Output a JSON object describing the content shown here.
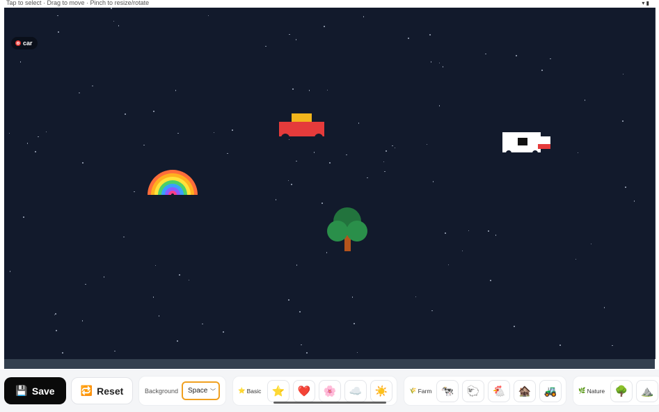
{
  "status_bar": {
    "hint": "Tap to select · Drag to move · Pinch to resize/rotate"
  },
  "canvas": {
    "background": "#121a2c",
    "selected_label": "car",
    "stickers": [
      "car",
      "bus",
      "rainbow",
      "tree"
    ]
  },
  "toolbar": {
    "save_label": "Save",
    "save_icon": "💾",
    "reset_label": "Reset",
    "reset_icon": "🔁",
    "background": {
      "label": "Background",
      "value": "Space"
    },
    "groups": [
      {
        "label": "Basic",
        "icon": "⭐",
        "items": [
          "⭐",
          "❤️",
          "🌸",
          "☁️",
          "☀️"
        ]
      },
      {
        "label": "Farm",
        "icon": "🌾",
        "items": [
          "🐄",
          "🐑",
          "🐔",
          "🏚️",
          "🚜"
        ]
      },
      {
        "label": "Nature",
        "icon": "🌿",
        "items": [
          "🌳",
          "⛰️"
        ]
      }
    ]
  },
  "colors": {
    "accent": "#f0a020",
    "dark": "#0a0a0a",
    "sky": "#121a2c"
  }
}
